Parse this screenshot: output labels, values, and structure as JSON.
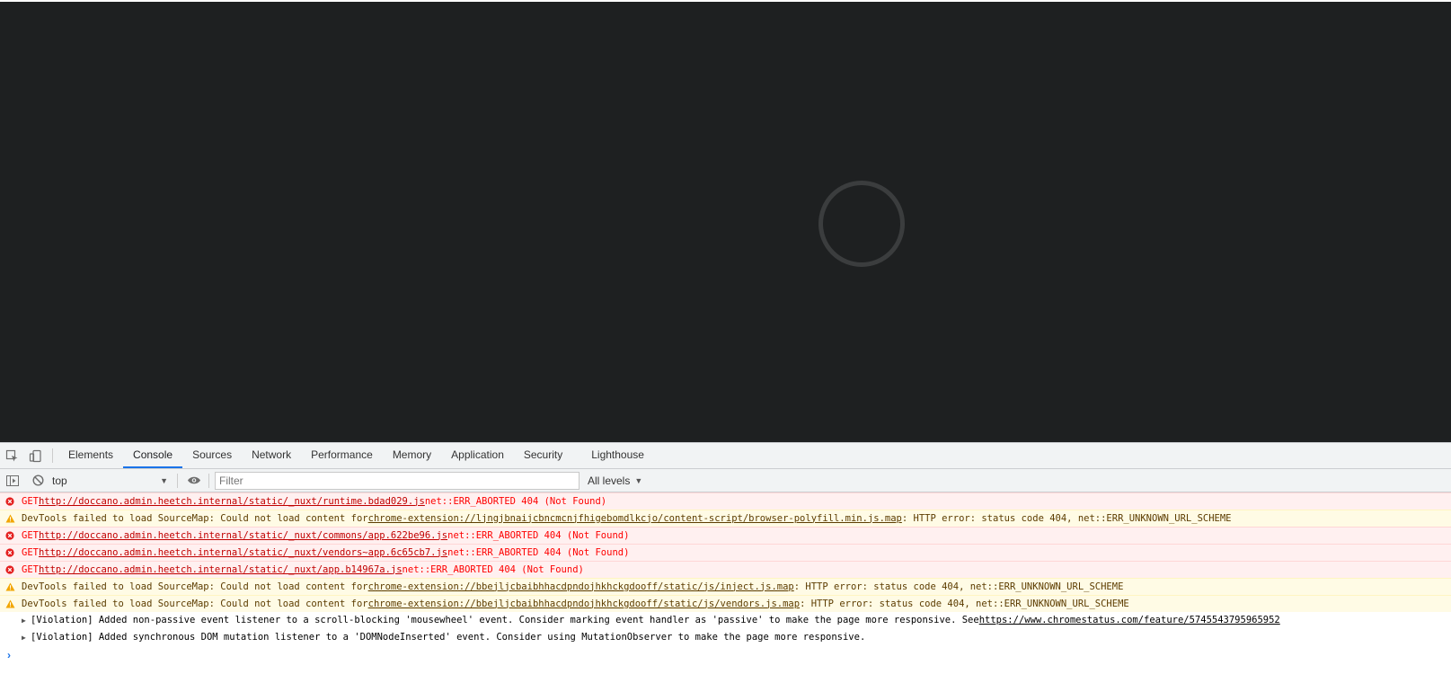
{
  "devtools": {
    "tabs": [
      {
        "label": "Elements",
        "active": false
      },
      {
        "label": "Console",
        "active": true
      },
      {
        "label": "Sources",
        "active": false
      },
      {
        "label": "Network",
        "active": false
      },
      {
        "label": "Performance",
        "active": false
      },
      {
        "label": "Memory",
        "active": false
      },
      {
        "label": "Application",
        "active": false
      },
      {
        "label": "Security",
        "active": false
      },
      {
        "label": "Lighthouse",
        "active": false
      }
    ],
    "toolbar": {
      "context": "top",
      "filter_placeholder": "Filter",
      "levels": "All levels"
    },
    "messages": [
      {
        "level": "error",
        "prefix": "GET ",
        "link": "http://doccano.admin.heetch.internal/static/_nuxt/runtime.bdad029.js",
        "suffix": " net::ERR_ABORTED 404 (Not Found)"
      },
      {
        "level": "warning",
        "prefix": "DevTools failed to load SourceMap: Could not load content for ",
        "link": "chrome-extension://ljngjbnaijcbncmcnjfhigebomdlkcjo/content-script/browser-polyfill.min.js.map",
        "suffix": ": HTTP error: status code 404, net::ERR_UNKNOWN_URL_SCHEME"
      },
      {
        "level": "error",
        "prefix": "GET ",
        "link": "http://doccano.admin.heetch.internal/static/_nuxt/commons/app.622be96.js",
        "suffix": " net::ERR_ABORTED 404 (Not Found)"
      },
      {
        "level": "error",
        "prefix": "GET ",
        "link": "http://doccano.admin.heetch.internal/static/_nuxt/vendors~app.6c65cb7.js",
        "suffix": " net::ERR_ABORTED 404 (Not Found)"
      },
      {
        "level": "error",
        "prefix": "GET ",
        "link": "http://doccano.admin.heetch.internal/static/_nuxt/app.b14967a.js",
        "suffix": " net::ERR_ABORTED 404 (Not Found)"
      },
      {
        "level": "warning",
        "prefix": "DevTools failed to load SourceMap: Could not load content for ",
        "link": "chrome-extension://bbejljcbaibhhacdpndojhkhckgdooff/static/js/inject.js.map",
        "suffix": ": HTTP error: status code 404, net::ERR_UNKNOWN_URL_SCHEME"
      },
      {
        "level": "warning",
        "prefix": "DevTools failed to load SourceMap: Could not load content for ",
        "link": "chrome-extension://bbejljcbaibhhacdpndojhkhckgdooff/static/js/vendors.js.map",
        "suffix": ": HTTP error: status code 404, net::ERR_UNKNOWN_URL_SCHEME"
      },
      {
        "level": "violation",
        "prefix": "[Violation] Added non-passive event listener to a scroll-blocking 'mousewheel' event. Consider marking event handler as 'passive' to make the page more responsive. See ",
        "link": "https://www.chromestatus.com/feature/5745543795965952",
        "suffix": ""
      },
      {
        "level": "violation",
        "prefix": "[Violation] Added synchronous DOM mutation listener to a 'DOMNodeInserted' event. Consider using MutationObserver to make the page more responsive.",
        "link": "",
        "suffix": ""
      }
    ]
  }
}
